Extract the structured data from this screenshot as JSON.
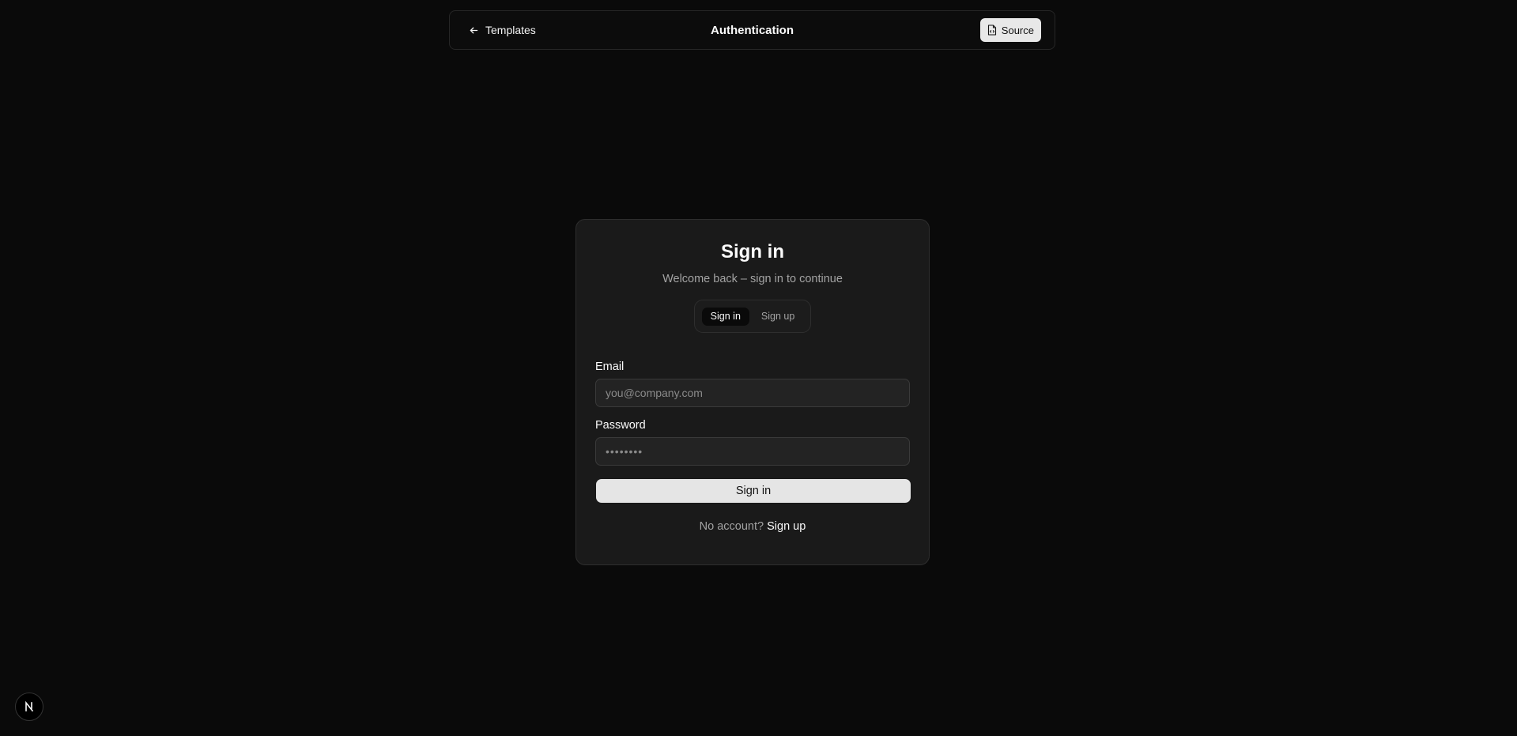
{
  "header": {
    "back_label": "Templates",
    "title": "Authentication",
    "source_label": "Source",
    "back_icon": "arrow-left-icon",
    "source_icon": "file-code-icon"
  },
  "card": {
    "title": "Sign in",
    "subtitle": "Welcome back – sign in to continue",
    "tabs": [
      {
        "label": "Sign in",
        "active": true
      },
      {
        "label": "Sign up",
        "active": false
      }
    ],
    "email": {
      "label": "Email",
      "placeholder": "you@company.com",
      "value": ""
    },
    "password": {
      "label": "Password",
      "placeholder": "••••••••",
      "value": ""
    },
    "submit_label": "Sign in",
    "footer_prompt": "No account?",
    "footer_link": "Sign up"
  },
  "badge": {
    "icon": "nextjs-logo-icon"
  },
  "colors": {
    "background": "#0a0a0a",
    "card": "#1a1a1a",
    "primary_button": "#e5e5e5",
    "muted_text": "#a3a3a3"
  }
}
